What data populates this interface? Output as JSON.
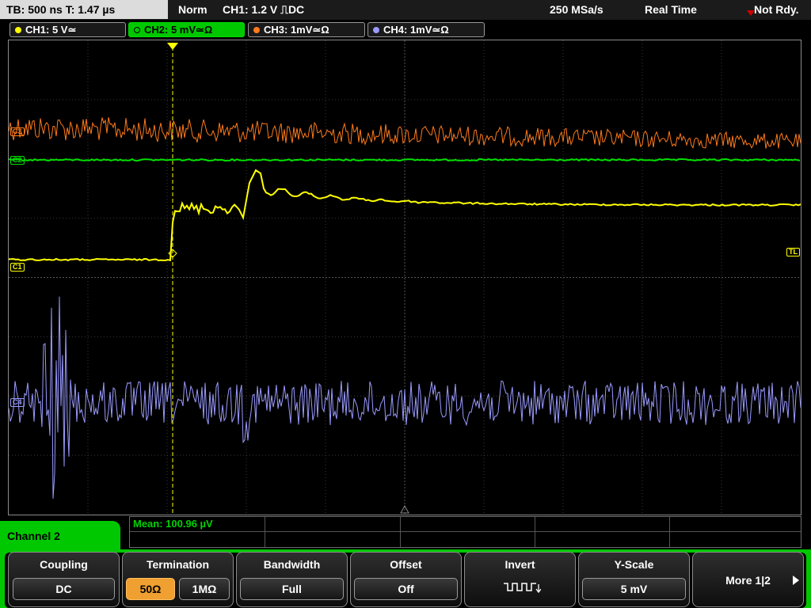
{
  "status_bar": {
    "timebase": "TB: 500 ns   T: 1.47 µs",
    "trigger_mode": "Norm",
    "trigger_info": "CH1: 1.2 V ⎍DC",
    "sample_rate": "250 MSa/s",
    "acq_mode": "Real Time",
    "status": "Not Rdy."
  },
  "channel_tabs": [
    {
      "label": "CH1: 5 V≃",
      "color": "#ffff00",
      "active": false
    },
    {
      "label": "CH2: 5 mV≃Ω",
      "color": "#00e000",
      "active": true
    },
    {
      "label": "CH3: 1mV≃Ω",
      "color": "#ff7a1a",
      "active": false
    },
    {
      "label": "CH4: 1mV≃Ω",
      "color": "#9a9aff",
      "active": false
    }
  ],
  "markers": {
    "ch3": "C3",
    "ch2": "C2",
    "ch1": "C1",
    "ch4": "C4",
    "trigger_level": "TL",
    "trigger_pos": "T"
  },
  "measurement": {
    "mean": "Mean: 100.96 µV"
  },
  "menu": {
    "channel_title": "Channel 2",
    "coupling": {
      "title": "Coupling",
      "value": "DC"
    },
    "termination": {
      "title": "Termination",
      "options": [
        "50Ω",
        "1MΩ"
      ],
      "selected": "50Ω"
    },
    "bandwidth": {
      "title": "Bandwidth",
      "value": "Full"
    },
    "offset": {
      "title": "Offset",
      "value": "Off"
    },
    "invert": {
      "title": "Invert",
      "icon": "invert-waveform-icon"
    },
    "yscale": {
      "title": "Y-Scale",
      "value": "5 mV"
    },
    "more": {
      "label": "More 1|2",
      "icon": "arrow-right-icon"
    }
  },
  "colors": {
    "ch1": "#ffff00",
    "ch2": "#00e000",
    "ch3": "#ff7a1a",
    "ch4": "#9a9aff",
    "accent": "#00c800",
    "selected": "#f0a030"
  }
}
